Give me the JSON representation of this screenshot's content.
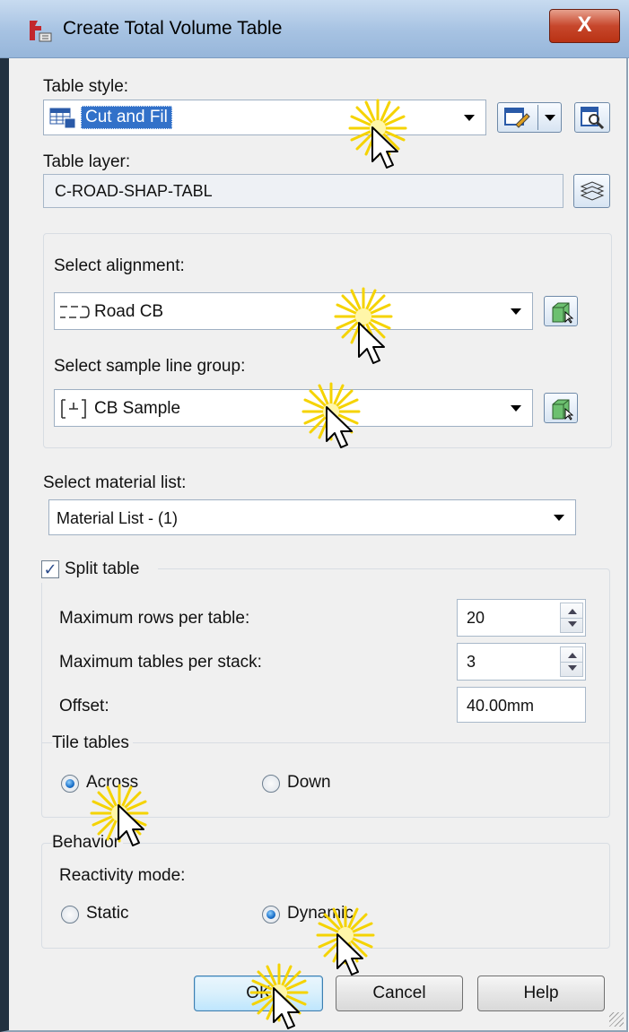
{
  "window": {
    "title": "Create Total Volume Table",
    "close_glyph": "X"
  },
  "table_style": {
    "label": "Table style:",
    "value": "Cut and Fil"
  },
  "table_layer": {
    "label": "Table layer:",
    "value": "C-ROAD-SHAP-TABL"
  },
  "alignment": {
    "label": "Select alignment:",
    "value": "Road CB"
  },
  "sample_line_group": {
    "label": "Select sample line group:",
    "value": "CB Sample"
  },
  "material_list": {
    "label": "Select material list:",
    "value": "Material List - (1)"
  },
  "split_table": {
    "label": "Split table",
    "checked": true,
    "max_rows": {
      "label": "Maximum rows per table:",
      "value": "20"
    },
    "max_tables": {
      "label": "Maximum tables per stack:",
      "value": "3"
    },
    "offset": {
      "label": "Offset:",
      "value": "40.00mm"
    }
  },
  "tile_tables": {
    "label": "Tile tables",
    "across": "Across",
    "down": "Down",
    "selected": "Across"
  },
  "behavior": {
    "label": "Behavior",
    "reactivity_label": "Reactivity mode:",
    "static": "Static",
    "dynamic": "Dynamic",
    "selected": "Dynamic"
  },
  "buttons": {
    "ok": "OK",
    "cancel": "Cancel",
    "help": "Help"
  },
  "icons": [
    "app-icon",
    "table-style-icon",
    "edit-style-icon",
    "preview-icon",
    "layer-icon",
    "alignment-icon",
    "pick-from-drawing-icon",
    "sample-line-icon",
    "radio-icon",
    "checkbox-icon",
    "spinner-icon",
    "cursor-icon",
    "highlight-burst-icon"
  ],
  "colors": {
    "selection": "#3271c9",
    "titlebar": "#a6c2e2",
    "close_button": "#c7472c",
    "highlight": "#f5d300"
  }
}
